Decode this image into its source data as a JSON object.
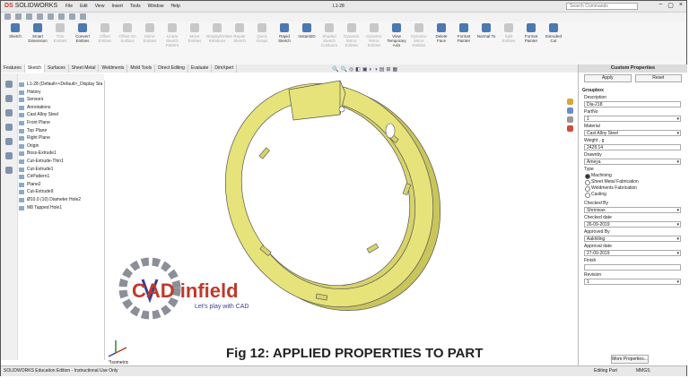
{
  "app": {
    "name": "SOLIDWORKS",
    "brand": "DS",
    "doc_title": "L1-28"
  },
  "menu": [
    "File",
    "Edit",
    "View",
    "Insert",
    "Tools",
    "Window",
    "Help"
  ],
  "search": {
    "placeholder": "Search Commands"
  },
  "commands": [
    {
      "label": "Sketch",
      "enabled": true
    },
    {
      "label": "Smart Dimension",
      "enabled": true
    },
    {
      "label": "Trim Entities",
      "enabled": false
    },
    {
      "label": "Convert Entities",
      "enabled": true
    },
    {
      "label": "Offset Entities",
      "enabled": false
    },
    {
      "label": "Offset On Surface",
      "enabled": false
    },
    {
      "label": "Mirror Entities",
      "enabled": false
    },
    {
      "label": "Linear Sketch Pattern",
      "enabled": false
    },
    {
      "label": "Move Entities",
      "enabled": false
    },
    {
      "label": "Display/Delete Relations",
      "enabled": false
    },
    {
      "label": "Repair Sketch",
      "enabled": false
    },
    {
      "label": "Quick Snaps",
      "enabled": false
    },
    {
      "label": "Rapid Sketch",
      "enabled": true
    },
    {
      "label": "Instant2D",
      "enabled": true
    },
    {
      "label": "Shaded Sketch Contours",
      "enabled": false
    },
    {
      "label": "Dynamic Mirror Entities",
      "enabled": false
    },
    {
      "label": "Dynamic Mirror Entities",
      "enabled": false
    },
    {
      "label": "View Temporary Axis",
      "enabled": true
    },
    {
      "label": "Dynamic Mirror Entities",
      "enabled": false
    },
    {
      "label": "Delete Face",
      "enabled": true
    },
    {
      "label": "Format Painter",
      "enabled": true
    },
    {
      "label": "Normal To",
      "enabled": true
    },
    {
      "label": "Split Entities",
      "enabled": false
    },
    {
      "label": "Format Painter",
      "enabled": true
    },
    {
      "label": "Extruded Cut",
      "enabled": true
    }
  ],
  "tabs": [
    "Features",
    "Sketch",
    "Surfaces",
    "Sheet Metal",
    "Weldments",
    "Mold Tools",
    "Direct Editing",
    "Evaluate",
    "DimXpert"
  ],
  "active_tab": "Sketch",
  "tree": [
    "L1-28 (Default<<Default>_Display Sta",
    "History",
    "Sensors",
    "Annotations",
    "Cast Alloy Steel",
    "Front Plane",
    "Top Plane",
    "Right Plane",
    "Origin",
    "Boss-Extrude1",
    "Cut-Extrude-Thin1",
    "Cut-Extrude1",
    "CirPattern1",
    "Plane2",
    "Cut-Extrude9",
    "Ø10.0 (10) Diameter Hole2",
    "M8 Tapped Hole1"
  ],
  "viewport": {
    "orientation": "*Isometric",
    "caption": "Fig 12: APPLIED PROPERTIES TO PART",
    "watermark_brand": "CAD infield",
    "watermark_tagline": "Let's play with CAD",
    "part_color": "#e6e37a"
  },
  "panel": {
    "title": "Custom Properties",
    "apply": "Apply",
    "reset": "Reset",
    "group": "Groupbox",
    "fields": [
      {
        "label": "Description",
        "value": "Dia-218"
      },
      {
        "label": "PartNo",
        "value": "1"
      },
      {
        "label": "Material",
        "value": "Cast Alloy Steel"
      },
      {
        "label": "Weight , g",
        "value": "2428.14"
      },
      {
        "label": "Drawnby",
        "value": "Ameya"
      }
    ],
    "type_label": "Type",
    "type_options": [
      "Machining",
      "Sheet Metal Fabrication",
      "Weldments Fabrication",
      "Casting"
    ],
    "type_selected": "Machining",
    "fields2": [
      {
        "label": "Checked By",
        "value": "Shrinivas"
      },
      {
        "label": "Checked date",
        "value": "26-09-2019"
      },
      {
        "label": "Approved By",
        "value": "Aakhiling"
      },
      {
        "label": "Approval date",
        "value": "27-09-2019"
      },
      {
        "label": "Finish",
        "value": ""
      },
      {
        "label": "Revision",
        "value": "1"
      }
    ],
    "more": "More Properties..."
  },
  "status": {
    "left": "SOLIDWORKS Education Edition - Instructional Use Only",
    "mode": "Editing Part",
    "units": "MMGS"
  }
}
